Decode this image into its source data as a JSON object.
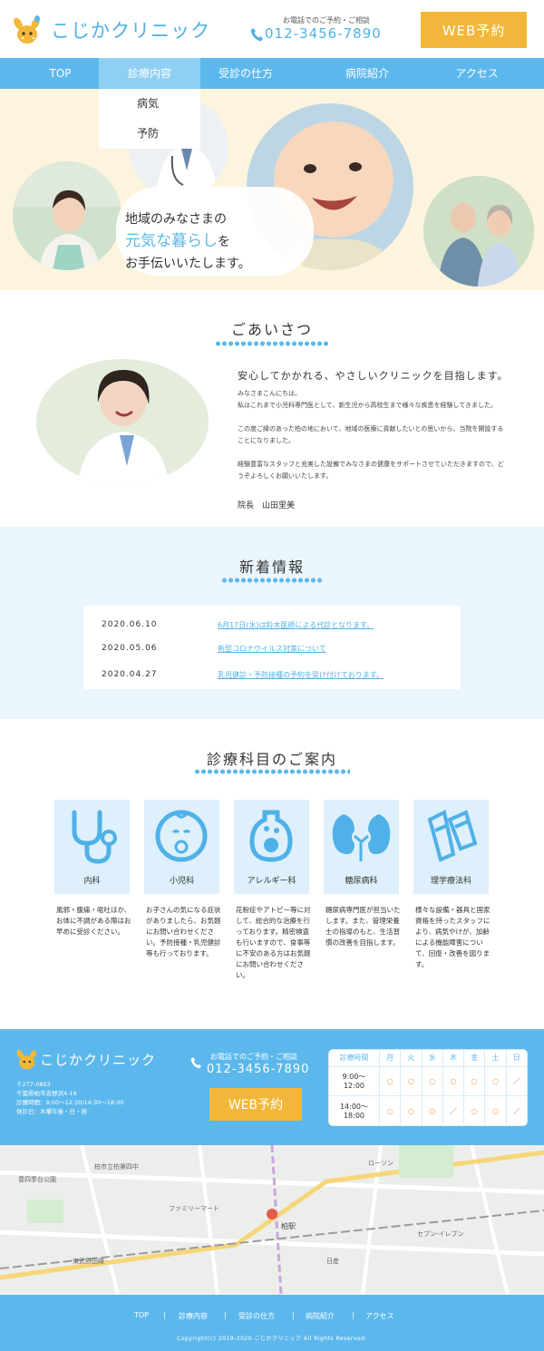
{
  "header": {
    "logo_text": "こじかクリニック",
    "tel_caption": "お電話でのご予約・ご相談",
    "tel_number": "012-3456-7890",
    "web_button": "WEB予約"
  },
  "nav": {
    "items": [
      "TOP",
      "診療内容",
      "受診の仕方",
      "病院紹介",
      "アクセス"
    ],
    "dropdown": [
      "病気",
      "予防"
    ]
  },
  "hero": {
    "line1": "地域のみなさまの",
    "line2_accent": "元気な暮らし",
    "line2_rest": "を",
    "line3": "お手伝いいたします。"
  },
  "greeting": {
    "title": "ごあいさつ",
    "lead": "安心してかかれる、やさしいクリニックを目指します。",
    "paragraphs": [
      "みなさまこんにちは。\n私はこれまで小児科専門医として、新生児から高校生まで様々な疾患を経験してきました。",
      "この度ご縁のあった柏の地において、地域の医療に貢献したいとの思いから、当院を開設することになりました。",
      "経験豊富なスタッフと充実した設備でみなさまの健康をサポートさせていただきますので、どうぞよろしくお願いいたします。"
    ],
    "signature": "院長　山田里美"
  },
  "news": {
    "title": "新着情報",
    "items": [
      {
        "date": "2020.06.10",
        "text": "6月17日(水)は鈴木医師による代診となります。"
      },
      {
        "date": "2020.05.06",
        "text": "新型コロナウイルス対策について"
      },
      {
        "date": "2020.04.27",
        "text": "乳児健診・予防接種の予約を受け付けております。"
      }
    ]
  },
  "departments": {
    "title": "診療科目のご案内",
    "items": [
      {
        "name": "内科",
        "icon": "stethoscope-icon",
        "desc": "風邪・腹痛・嘔吐ほか、お体に不調がある際はお早めに受診ください。"
      },
      {
        "name": "小児科",
        "icon": "baby-icon",
        "desc": "お子さんの気になる症状がありましたら、お気軽にお問い合わせください。予防接種・乳児健診等も行っております。"
      },
      {
        "name": "アレルギー科",
        "icon": "allergy-icon",
        "desc": "花粉症やアトピー等に対して、総合的な治療を行っております。精密検査も行いますので、食事等に不安のある方はお気軽にお問い合わせください。"
      },
      {
        "name": "糖尿病科",
        "icon": "kidney-icon",
        "desc": "糖尿病専門医が担当いたします。また、管理栄養士の指導のもと、生活習慣の改善を目指します。"
      },
      {
        "name": "理学療法科",
        "icon": "crutch-icon",
        "desc": "様々な設備・器具と国家資格を持ったスタッフにより、病気やけが、加齢による機能障害について、回復・改善を図ります。"
      }
    ]
  },
  "footer_info": {
    "logo_text": "こじかクリニック",
    "address": [
      "〒277-0853",
      "千葉県柏市吉野沢4-16",
      "診療時間：9:00〜12:30/14:30〜18:00",
      "休診日：木曜午後・日・祝"
    ],
    "tel_caption": "お電話でのご予約・ご相談",
    "tel_number": "012-3456-7890",
    "web_button": "WEB予約",
    "hours_table": {
      "header": [
        "診療時間",
        "月",
        "火",
        "水",
        "木",
        "金",
        "土",
        "日"
      ],
      "rows": [
        {
          "time": "9:00〜\n12:00",
          "marks": [
            "○",
            "○",
            "○",
            "○",
            "○",
            "○",
            "／"
          ]
        },
        {
          "time": "14:00〜\n18:00",
          "marks": [
            "○",
            "○",
            "○",
            "／",
            "○",
            "○",
            "／"
          ]
        }
      ]
    }
  },
  "map": {
    "labels": [
      "柏市立柏第四中",
      "ファミリーマート",
      "東武野田線",
      "柏駅",
      "セブン-イレブン",
      "ローソン",
      "日産",
      "豊四季台公園"
    ]
  },
  "footer": {
    "nav": [
      "TOP",
      "診療内容",
      "受診の仕方",
      "病院紹介",
      "アクセス"
    ],
    "copyright": "Copyright(c) 2019-2020 こじかクリニック All Rights Reserved."
  },
  "colors": {
    "accent": "#5cb8ec",
    "button": "#f2b73a",
    "hero_bg": "#fdf4de",
    "news_bg": "#eaf5fc"
  }
}
